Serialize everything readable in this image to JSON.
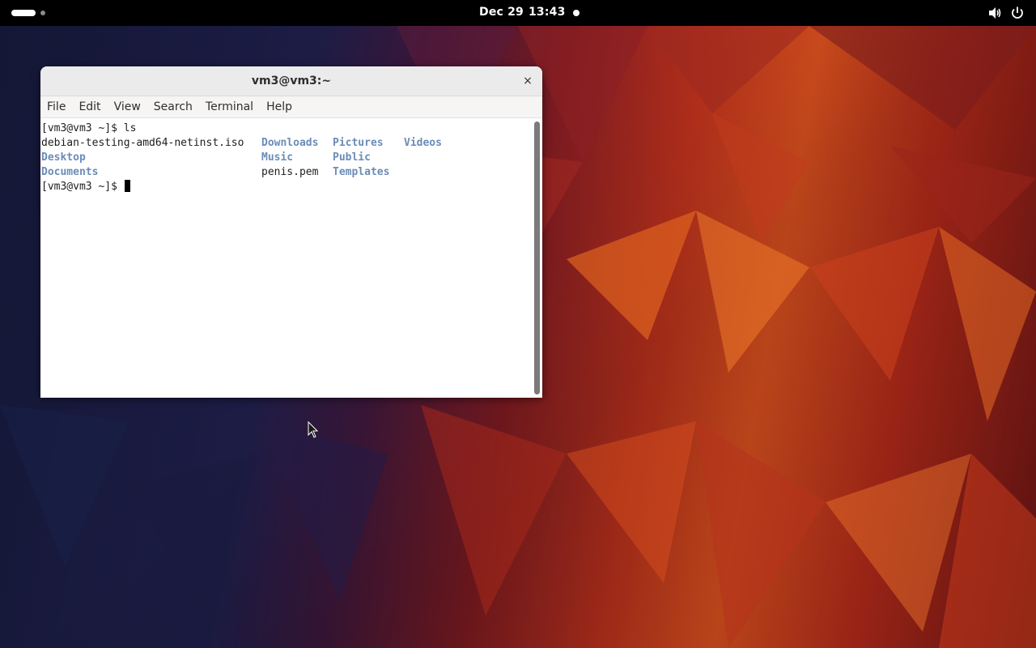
{
  "topbar": {
    "date": "Dec 29",
    "time": "13:43",
    "volume_icon": "speaker-icon",
    "power_icon": "power-icon"
  },
  "window": {
    "title": "vm3@vm3:~",
    "close_label": "×",
    "menu": [
      "File",
      "Edit",
      "View",
      "Search",
      "Terminal",
      "Help"
    ]
  },
  "terminal": {
    "prompt": "[vm3@vm3 ~]$",
    "command": "ls",
    "listing": {
      "row1": [
        "debian-testing-amd64-netinst.iso",
        "Downloads",
        "Pictures",
        "Videos"
      ],
      "row2": [
        "Desktop",
        "Music",
        "Public"
      ],
      "row3": [
        "Documents",
        "penis.pem",
        "Templates"
      ]
    },
    "directory_color": "#6b8cb8"
  }
}
